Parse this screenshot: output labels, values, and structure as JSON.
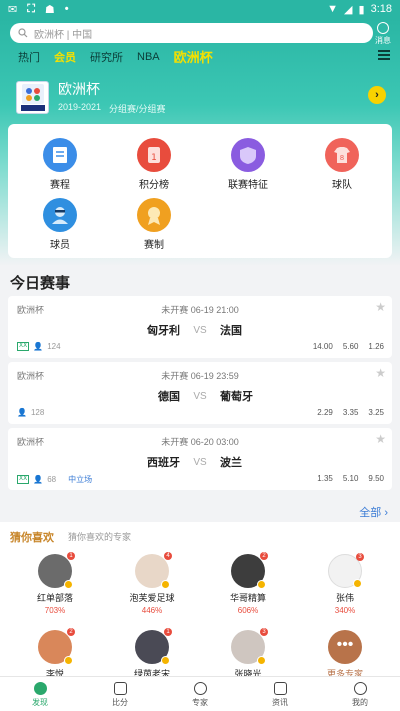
{
  "status_bar": {
    "carrier_icons": [
      "notification-icon",
      "app-icon",
      "android-icon",
      "dot"
    ],
    "time": "3:18"
  },
  "header": {
    "search_placeholder": "欧洲杯 | 中国",
    "message_label": "消息",
    "tabs": [
      {
        "label": "热门",
        "active": false
      },
      {
        "label": "会员",
        "active": true
      },
      {
        "label": "研究所",
        "active": false
      },
      {
        "label": "NBA",
        "active": false
      },
      {
        "label": "欧洲杯",
        "active": true
      }
    ],
    "league": {
      "logo_text": "EURO2020",
      "name": "欧洲杯",
      "season": "2019-2021",
      "stage": "分组赛/分组赛"
    }
  },
  "features": [
    {
      "label": "赛程",
      "icon": "schedule-icon",
      "color": "#3b8de8"
    },
    {
      "label": "积分榜",
      "icon": "standings-icon",
      "color": "#e84c3d"
    },
    {
      "label": "联赛特征",
      "icon": "shield-icon",
      "color": "#8a5ce0"
    },
    {
      "label": "球队",
      "icon": "jersey-icon",
      "color": "#f0635a"
    },
    {
      "label": "球员",
      "icon": "player-icon",
      "color": "#2f8fe0"
    },
    {
      "label": "赛制",
      "icon": "medal-icon",
      "color": "#f0a020"
    }
  ],
  "today_title": "今日赛事",
  "matches": [
    {
      "league": "欧洲杯",
      "status": "未开赛",
      "time": "06-19 21:00",
      "home": "匈牙利",
      "away": "法国",
      "vs": "VS",
      "count": "124",
      "has_tag": true,
      "neutral": "",
      "odds": [
        "14.00",
        "5.60",
        "1.26"
      ]
    },
    {
      "league": "欧洲杯",
      "status": "未开赛",
      "time": "06-19 23:59",
      "home": "德国",
      "away": "葡萄牙",
      "vs": "VS",
      "count": "128",
      "has_tag": false,
      "neutral": "",
      "odds": [
        "2.29",
        "3.35",
        "3.25"
      ]
    },
    {
      "league": "欧洲杯",
      "status": "未开赛",
      "time": "06-20 03:00",
      "home": "西班牙",
      "away": "波兰",
      "vs": "VS",
      "count": "68",
      "has_tag": true,
      "neutral": "中立场",
      "odds": [
        "1.35",
        "5.10",
        "9.50"
      ]
    }
  ],
  "all_link": "全部",
  "guess": {
    "title": "猜你喜欢",
    "subtitle": "猜你喜欢的专家",
    "experts": [
      {
        "name": "红单部落",
        "rate": "703%",
        "badge": "1"
      },
      {
        "name": "泡芙爱足球",
        "rate": "446%",
        "badge": "4"
      },
      {
        "name": "华哥精算",
        "rate": "606%",
        "badge": "2"
      },
      {
        "name": "张伟",
        "rate": "340%",
        "badge": "3"
      },
      {
        "name": "李悦",
        "rate": "",
        "badge": "2"
      },
      {
        "name": "绿茵老宋",
        "rate": "",
        "badge": "1"
      },
      {
        "name": "张晓光",
        "rate": "",
        "badge": "3"
      },
      {
        "name": "更多专家",
        "rate": "",
        "badge": ""
      }
    ]
  },
  "bottom_nav": [
    {
      "label": "发现",
      "active": true
    },
    {
      "label": "比分",
      "active": false
    },
    {
      "label": "专家",
      "active": false
    },
    {
      "label": "资讯",
      "active": false
    },
    {
      "label": "我的",
      "active": false
    }
  ]
}
